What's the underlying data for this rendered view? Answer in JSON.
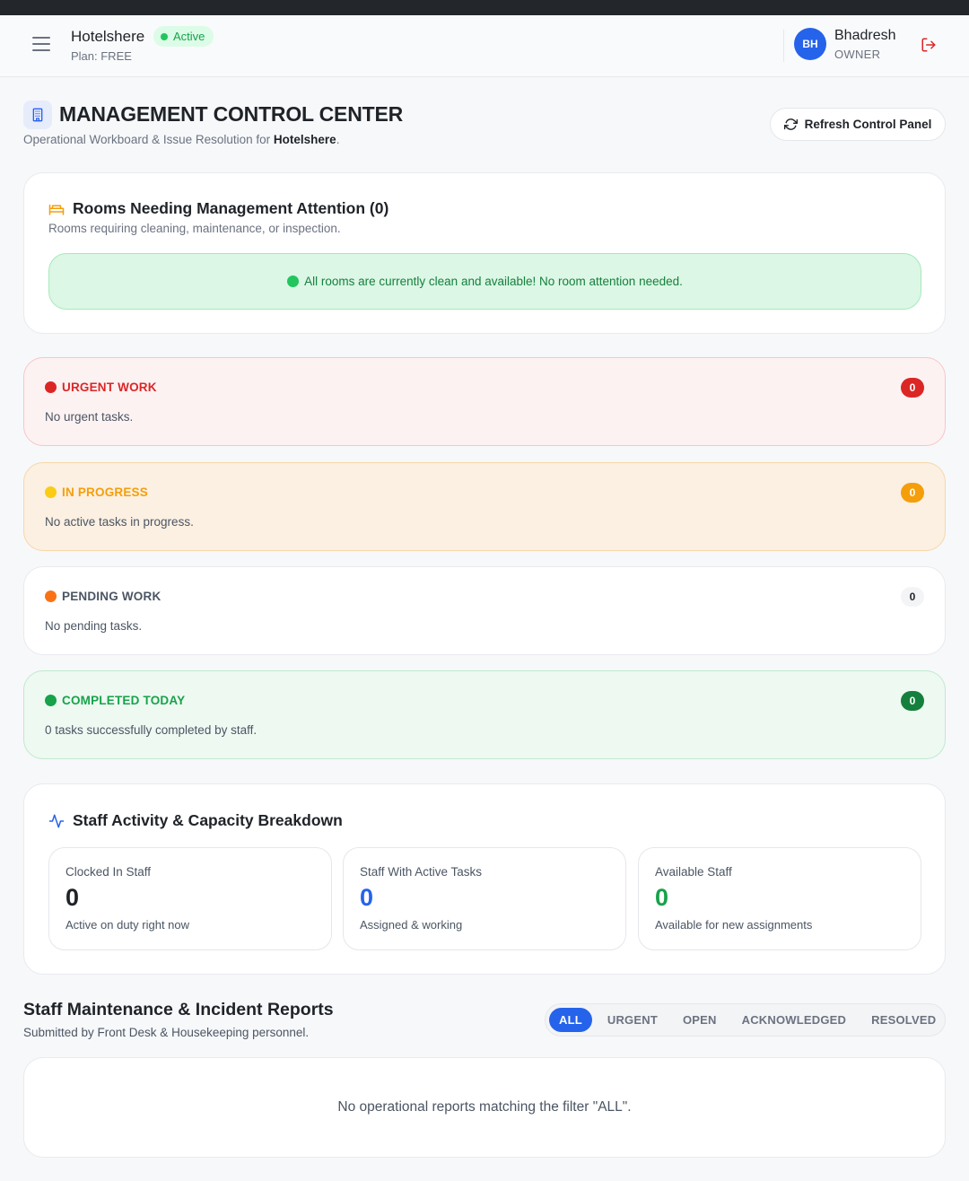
{
  "header": {
    "hotel_name": "Hotelshere",
    "status": "Active",
    "plan": "Plan: FREE",
    "user_initials": "BH",
    "user_name": "Bhadresh",
    "user_role": "OWNER"
  },
  "page": {
    "title": "MANAGEMENT CONTROL CENTER",
    "subtitle_prefix": "Operational Workboard & Issue Resolution for ",
    "subtitle_hotel": "Hotelshere",
    "subtitle_suffix": ".",
    "refresh_label": "Refresh Control Panel"
  },
  "rooms": {
    "title": "Rooms Needing Management Attention (0)",
    "subtitle": "Rooms requiring cleaning, maintenance, or inspection.",
    "alert": "All rooms are currently clean and available! No room attention needed."
  },
  "task_groups": [
    {
      "label": "URGENT WORK",
      "count": "0",
      "desc": "No urgent tasks.",
      "dot_color": "#dc2626"
    },
    {
      "label": "IN PROGRESS",
      "count": "0",
      "desc": "No active tasks in progress.",
      "dot_color": "#facc15"
    },
    {
      "label": "PENDING WORK",
      "count": "0",
      "desc": "No pending tasks.",
      "dot_color": "#f97316"
    },
    {
      "label": "COMPLETED TODAY",
      "count": "0",
      "desc": "0 tasks successfully completed by staff.",
      "dot_color": "#16a34a"
    }
  ],
  "staff": {
    "title": "Staff Activity & Capacity Breakdown",
    "stats": [
      {
        "label": "Clocked In Staff",
        "value": "0",
        "note": "Active on duty right now",
        "color": "#1f2328"
      },
      {
        "label": "Staff With Active Tasks",
        "value": "0",
        "note": "Assigned & working",
        "color": "#2563eb"
      },
      {
        "label": "Available Staff",
        "value": "0",
        "note": "Available for new assignments",
        "color": "#16a34a"
      }
    ]
  },
  "reports": {
    "title": "Staff Maintenance & Incident Reports",
    "subtitle": "Submitted by Front Desk & Housekeeping personnel.",
    "filters": [
      "ALL",
      "URGENT",
      "OPEN",
      "ACKNOWLEDGED",
      "RESOLVED"
    ],
    "active_filter": "ALL",
    "empty_message": "No operational reports matching the filter \"ALL\"."
  },
  "colors": {
    "accent": "#2563eb",
    "urgent": "#dc2626",
    "progress": "#f59e0b",
    "completed": "#16a34a",
    "alert_bg": "#dcf7e5"
  }
}
